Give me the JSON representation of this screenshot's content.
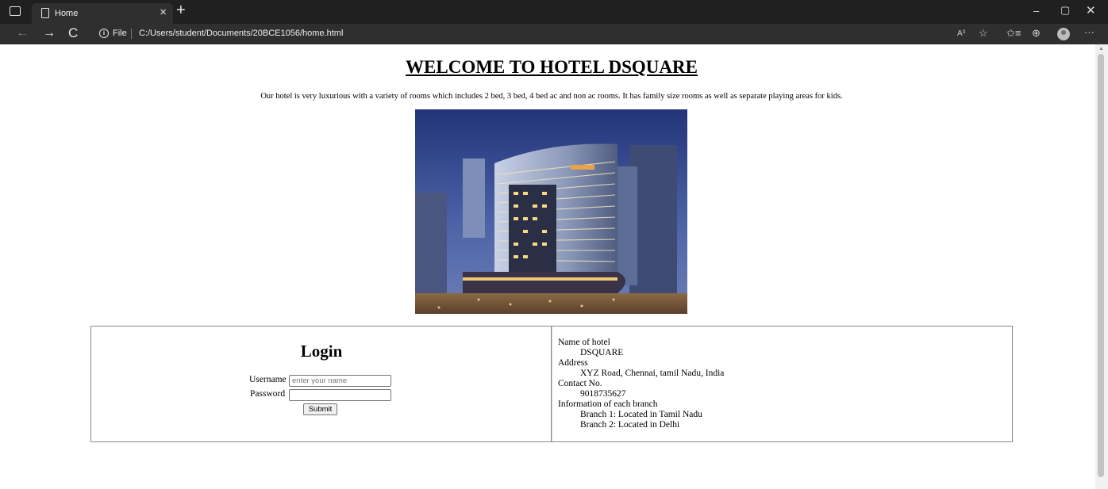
{
  "browser": {
    "tab_title": "Home",
    "tab_close": "×",
    "new_tab": "+",
    "file_label": "File",
    "url": "C:/Users/student/Documents/20BCE1056/home.html",
    "back": "←",
    "forward": "→",
    "reload": "C",
    "info": "i",
    "read_aloud": "A³",
    "favorite": "☆",
    "favorites": "✩≡",
    "collections": "⊕",
    "more": "···",
    "minimize": "–",
    "restore": "▢",
    "close": "✕"
  },
  "page": {
    "heading": "WELCOME TO HOTEL DSQUARE",
    "intro": "Our hotel is very luxurious with a variety of rooms which includes 2 bed, 3 bed, 4 bed ac and non ac rooms. It has family size rooms as well as separate playing areas for kids."
  },
  "login": {
    "title": "Login",
    "username_label": "Username",
    "username_placeholder": "enter your name",
    "password_label": "Password",
    "submit_label": "Submit"
  },
  "details": {
    "items": [
      {
        "term": "Name of hotel",
        "defs": [
          "DSQUARE"
        ]
      },
      {
        "term": "Address",
        "defs": [
          "XYZ Road, Chennai, tamil Nadu, India"
        ]
      },
      {
        "term": "Contact No.",
        "defs": [
          "9018735627"
        ]
      },
      {
        "term": "Information of each branch",
        "defs": [
          "Branch 1: Located in Tamil Nadu",
          "Branch 2: Located in Delhi"
        ]
      }
    ]
  }
}
